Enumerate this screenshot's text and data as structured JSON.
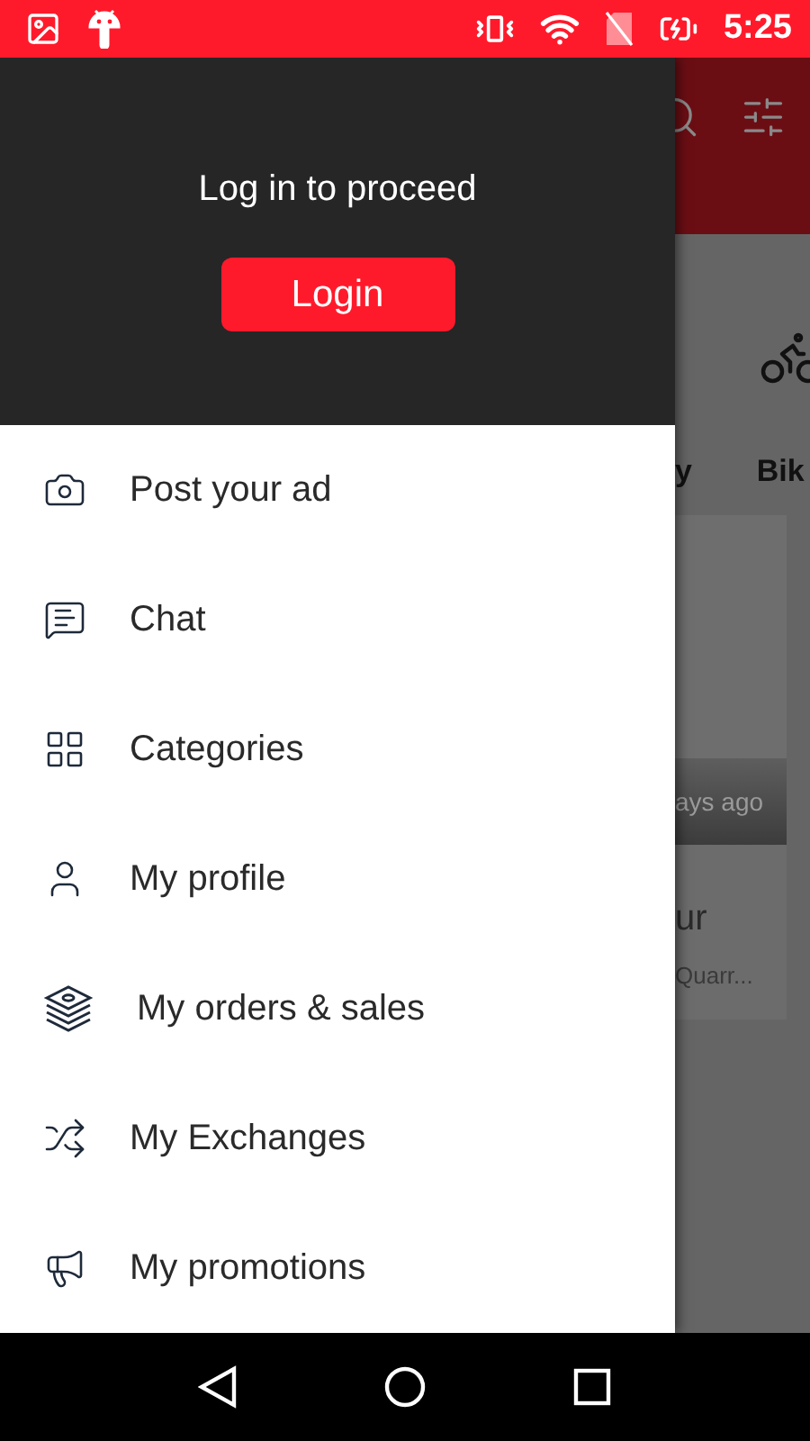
{
  "status_bar": {
    "time": "5:25"
  },
  "drawer": {
    "prompt": "Log in to proceed",
    "login_button": "Login",
    "items": [
      {
        "kind": "camera",
        "label": "Post your ad"
      },
      {
        "kind": "chat",
        "label": "Chat"
      },
      {
        "kind": "grid",
        "label": "Categories"
      },
      {
        "kind": "user",
        "label": "My profile"
      },
      {
        "kind": "money",
        "label": "My orders & sales"
      },
      {
        "kind": "shuffle",
        "label": "My Exchanges"
      },
      {
        "kind": "megaphone",
        "label": "My promotions"
      }
    ]
  },
  "background": {
    "category_labels": [
      "y",
      "Bik"
    ],
    "card_time": "ays ago",
    "card_title": "ur",
    "card_location": "Quarr..."
  }
}
